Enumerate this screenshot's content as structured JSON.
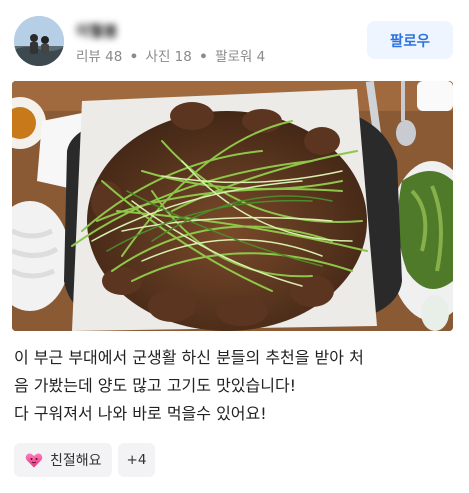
{
  "profile": {
    "name": "이혈봄",
    "stats": {
      "reviews": "리뷰 48",
      "photos": "사진 18",
      "followers": "팔로워 4",
      "separator": "•"
    },
    "follow_label": "팔로우"
  },
  "photo": {
    "icon": "food-photo"
  },
  "review": {
    "lines": [
      "이 부근 부대에서 군생활 하신 분들의 추천을 받아 처",
      "음 가봤는데 양도 많고 고기도 맛있습니다!",
      "다 구워져서 나와 바로 먹을수 있어요!"
    ]
  },
  "reactions": {
    "kind_label": "친절해요",
    "kind_icon": "heart-emoji-icon",
    "more_label": "+4"
  },
  "colors": {
    "accent": "#2c72e0",
    "follow_bg": "#eef5ff",
    "meta_text": "#8a8a8a"
  }
}
